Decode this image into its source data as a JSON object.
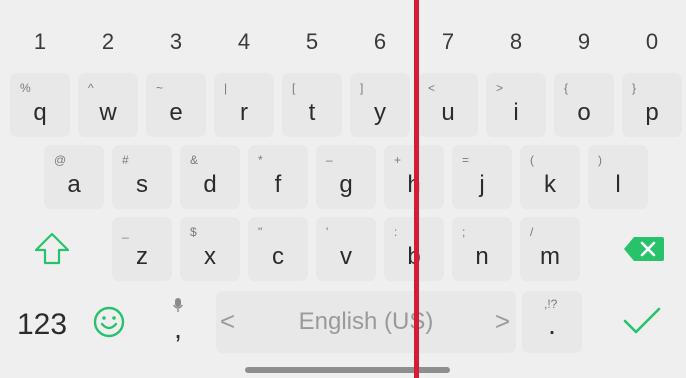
{
  "number_row": [
    "1",
    "2",
    "3",
    "4",
    "5",
    "6",
    "7",
    "8",
    "9",
    "0"
  ],
  "row1": [
    {
      "hint": "%",
      "label": "q"
    },
    {
      "hint": "^",
      "label": "w"
    },
    {
      "hint": "~",
      "label": "e"
    },
    {
      "hint": "|",
      "label": "r"
    },
    {
      "hint": "[",
      "label": "t"
    },
    {
      "hint": "]",
      "label": "y"
    },
    {
      "hint": "<",
      "label": "u"
    },
    {
      "hint": ">",
      "label": "i"
    },
    {
      "hint": "{",
      "label": "o"
    },
    {
      "hint": "}",
      "label": "p"
    }
  ],
  "row2": [
    {
      "hint": "@",
      "label": "a"
    },
    {
      "hint": "#",
      "label": "s"
    },
    {
      "hint": "&",
      "label": "d"
    },
    {
      "hint": "*",
      "label": "f"
    },
    {
      "hint": "–",
      "label": "g"
    },
    {
      "hint": "+",
      "label": "h"
    },
    {
      "hint": "=",
      "label": "j"
    },
    {
      "hint": "(",
      "label": "k"
    },
    {
      "hint": ")",
      "label": "l"
    }
  ],
  "row3": [
    {
      "hint": "_",
      "label": "z"
    },
    {
      "hint": "$",
      "label": "x"
    },
    {
      "hint": "\"",
      "label": "c"
    },
    {
      "hint": "'",
      "label": "v"
    },
    {
      "hint": ":",
      "label": "b"
    },
    {
      "hint": ";",
      "label": "n"
    },
    {
      "hint": "/",
      "label": "m"
    }
  ],
  "bottom": {
    "numbers_label": "123",
    "comma_label": ",",
    "space_label": "English (US)",
    "left_arrow": "<",
    "right_arrow": ">",
    "period_hint": ",!?",
    "period_label": "."
  },
  "colors": {
    "accent": "#27c26a",
    "divider": "#d81b35",
    "key": "#e8e8e8",
    "background": "#efefef"
  }
}
